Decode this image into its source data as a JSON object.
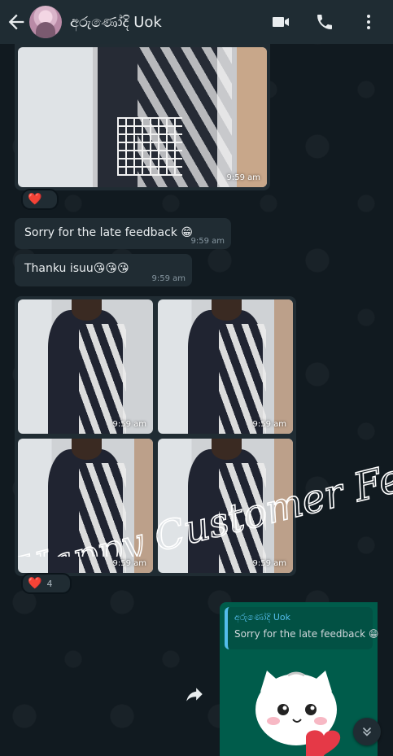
{
  "header": {
    "contact_name": "අරුණෝදි Uok"
  },
  "messages": [
    {
      "type": "image",
      "time": "9:59 am",
      "reaction": "❤️"
    },
    {
      "type": "text",
      "text": "Sorry for the late feedback 😁",
      "time": "9:59 am"
    },
    {
      "type": "text",
      "text": "Thanku isuu😘😘😘",
      "time": "9:59 am"
    },
    {
      "type": "image_group",
      "times": [
        "9:59 am",
        "9:59 am",
        "9:59 am",
        "9:59 am"
      ],
      "reaction": "❤️",
      "reaction_count": "4"
    },
    {
      "type": "sticker_reply",
      "quote_name": "අරුණෝදි Uok",
      "quote_text": "Sorry for the late feedback 😁"
    }
  ],
  "watermark": "Happy Customer Feedback",
  "icons": {
    "back": "arrow-left-icon",
    "video": "video-call-icon",
    "phone": "phone-icon",
    "menu": "more-vert-icon",
    "forward": "forward-icon",
    "scroll": "double-chevron-down-icon"
  },
  "colors": {
    "header_bg": "#1f2c33",
    "incoming_bubble": "#202c33",
    "outgoing_bubble": "#005c4b",
    "reply_accent": "#53bdeb",
    "reaction_heart": "#e0283e"
  }
}
